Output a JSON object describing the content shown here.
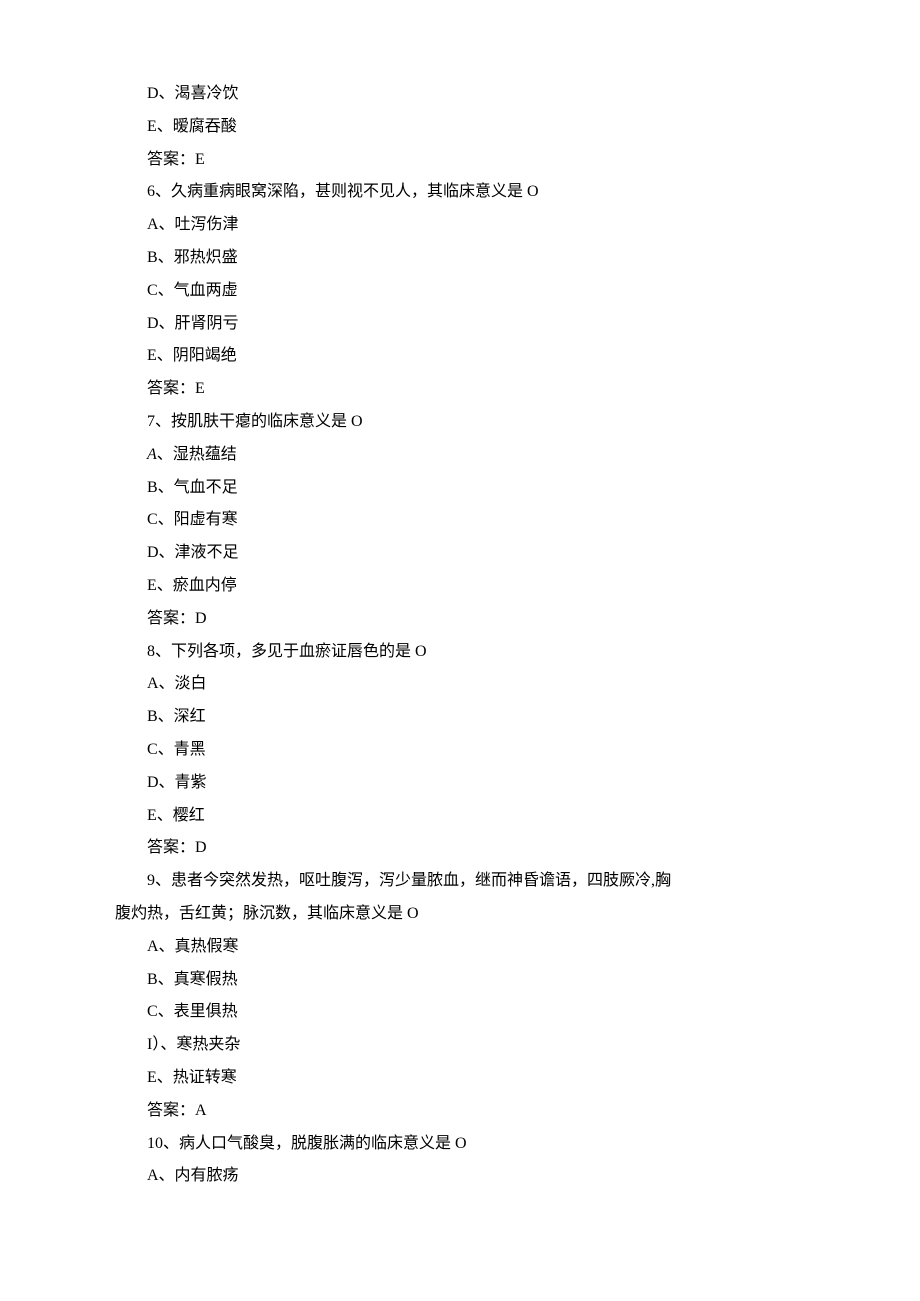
{
  "lines": [
    {
      "text": "D、渴喜冷饮",
      "indent": true
    },
    {
      "text": "E、暧腐吞酸",
      "indent": true
    },
    {
      "text": "答案：E",
      "indent": true
    },
    {
      "text": "6、久病重病眼窝深陷，甚则视不见人，其临床意义是 O",
      "indent": true
    },
    {
      "text": "A、吐泻伤津",
      "indent": true
    },
    {
      "text": "B、邪热炽盛",
      "indent": true
    },
    {
      "text": "C、气血两虚",
      "indent": true
    },
    {
      "text": "D、肝肾阴亏",
      "indent": true
    },
    {
      "text": "E、阴阳竭绝",
      "indent": true
    },
    {
      "text": "答案：E",
      "indent": true
    },
    {
      "text": "7、按肌肤干瘪的临床意义是 O",
      "indent": true
    },
    {
      "prefix_italic": "A",
      "text": "、湿热蕴结",
      "indent": true
    },
    {
      "text": "B、气血不足",
      "indent": true
    },
    {
      "text": "C、阳虚有寒",
      "indent": true
    },
    {
      "text": "D、津液不足",
      "indent": true
    },
    {
      "text": "E、瘀血内停",
      "indent": true
    },
    {
      "text": "答案：D",
      "indent": true
    },
    {
      "text": "8、下列各项，多见于血瘀证唇色的是 O",
      "indent": true
    },
    {
      "text": "A、淡白",
      "indent": true
    },
    {
      "text": "B、深红",
      "indent": true
    },
    {
      "text": "C、青黑",
      "indent": true
    },
    {
      "text": "D、青紫",
      "indent": true
    },
    {
      "text": "E、樱红",
      "indent": true
    },
    {
      "text": "答案：D",
      "indent": true
    },
    {
      "text": "9、患者今突然发热，呕吐腹泻，泻少量脓血，继而神昏谵语，四肢厥冷,胸",
      "indent": true
    },
    {
      "text": "腹灼热，舌红黄；脉沉数，其临床意义是 O",
      "indent": false
    },
    {
      "text": "A、真热假寒",
      "indent": true
    },
    {
      "text": "B、真寒假热",
      "indent": true
    },
    {
      "text": "C、表里俱热",
      "indent": true
    },
    {
      "text": "I）、寒热夹杂",
      "indent": true
    },
    {
      "text": "E、热证转寒",
      "indent": true
    },
    {
      "text": "答案：A",
      "indent": true
    },
    {
      "text": "10、病人口气酸臭，脱腹胀满的临床意义是 O",
      "indent": true
    },
    {
      "text": "A、内有脓疡",
      "indent": true
    }
  ]
}
